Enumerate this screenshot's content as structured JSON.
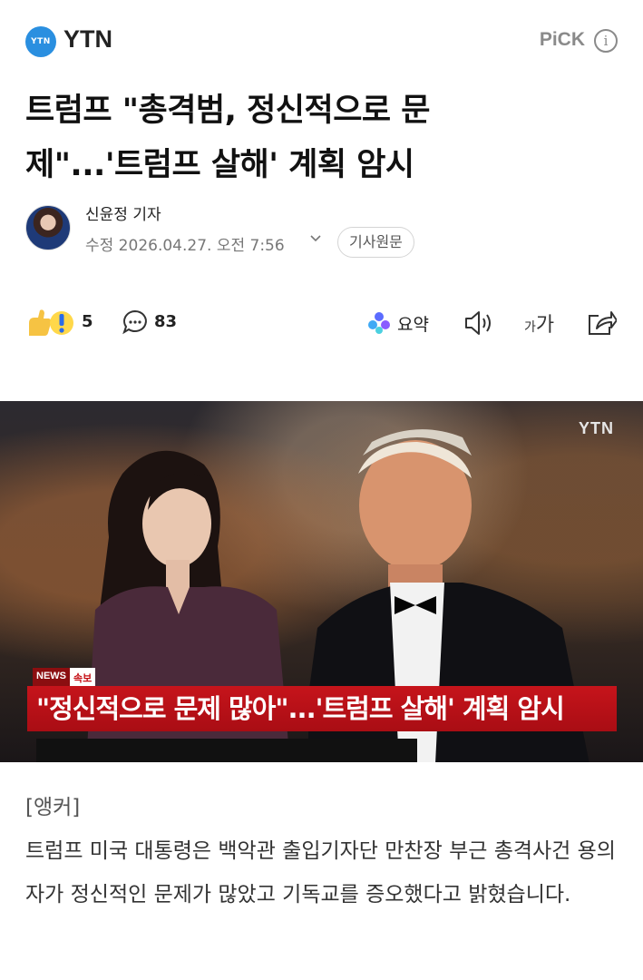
{
  "header": {
    "logo_badge": "YTN",
    "logo_text": "YTN",
    "pick_label": "PiCK",
    "info_symbol": "i"
  },
  "article": {
    "headline_line1": "트럼프 \"총격범, 정신적으로 문",
    "headline_line2": "제\"...'트럼프 살해' 계획 암시",
    "reporter_name": "신윤정 기자",
    "date": "수정 2026.04.27. 오전 7:56",
    "original_button": "기사원문"
  },
  "toolbar": {
    "reaction_count": "5",
    "comment_count": "83",
    "summary_label": "요약",
    "font_size_label_small": "가",
    "font_size_label_large": "가"
  },
  "video": {
    "watermark": "YTN",
    "news_tag": "NEWS",
    "breaking_tag": "속보",
    "caption": "\"정신적으로 문제 많아\"...'트럼프 살해' 계획 암시"
  },
  "body": {
    "anchor_label": "[앵커]",
    "paragraph": "트럼프 미국 대통령은 백악관 출입기자단 만찬장 부근 총격사건 용의자가 정신적인 문제가 많았고 기독교를 증오했다고 밝혔습니다."
  },
  "colors": {
    "accent_blue": "#2a8fe0",
    "breaking_red": "#c6141b"
  },
  "icons": [
    "info-icon",
    "reaction-icon",
    "comment-icon",
    "summary-icon",
    "speaker-icon",
    "font-size-icon",
    "share-icon",
    "chevron-down-icon"
  ]
}
